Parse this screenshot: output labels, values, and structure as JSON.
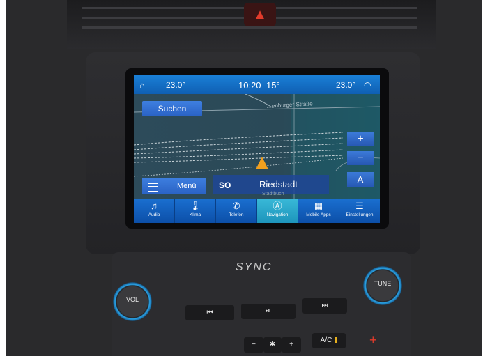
{
  "status": {
    "left_temp": "23.0°",
    "time": "10:20",
    "outside_temp": "15°",
    "right_temp": "23.0°"
  },
  "map": {
    "search_label": "Suchen",
    "zoom_in": "+",
    "zoom_out": "−",
    "compass": "A",
    "menu_label": "Menü",
    "direction": "SO",
    "street": "Riedstadt",
    "road_label": "…enburger-Straße",
    "city_label": "Stadtbuch"
  },
  "nav": [
    {
      "label": "Audio",
      "icon": "♫"
    },
    {
      "label": "Klima",
      "icon": "🌡"
    },
    {
      "label": "Telefon",
      "icon": "✆"
    },
    {
      "label": "Navigation",
      "icon": "Ⓐ"
    },
    {
      "label": "Mobile Apps",
      "icon": "▦"
    },
    {
      "label": "Einstellungen",
      "icon": "☰"
    }
  ],
  "console": {
    "brand": "SYNC",
    "vol_label": "VOL",
    "tune_label": "TUNE",
    "prev_label": "⏮",
    "play_label": "⏯",
    "next_label": "⏭",
    "fan_minus": "−",
    "fan_icon": "✱",
    "fan_plus": "+",
    "ac_label": "A/C",
    "hazard": "▲"
  },
  "colors": {
    "accent": "#1a7fd6",
    "active_tab": "#39b9d8",
    "ring": "#2aa4e8"
  }
}
